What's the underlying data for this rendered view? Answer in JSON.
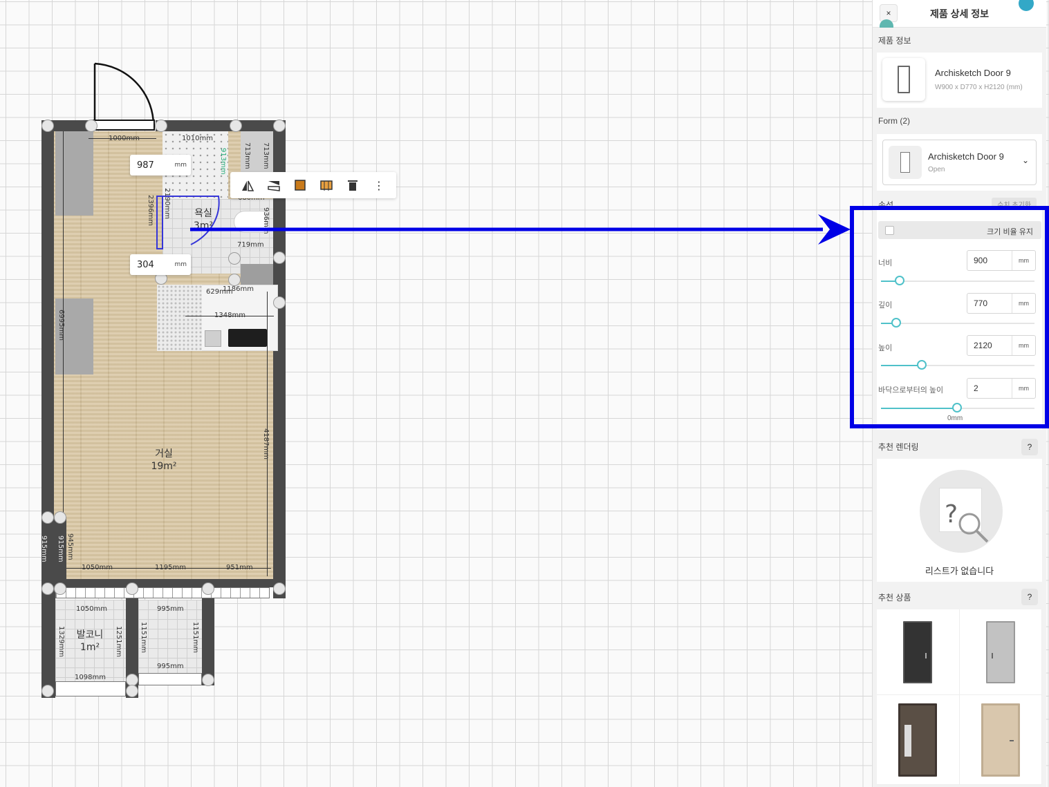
{
  "floorplan": {
    "dimensions": {
      "top_left": "1000mm",
      "top_bath": "1010mm",
      "bath_mid": "680mm",
      "right_v1": "713mm",
      "right_v2": "713mm",
      "bath_right_v": "936mm",
      "bath_h": "719mm",
      "bath_v_left": "2396mm",
      "bath_v_right": "2190mm",
      "small_v": "913mm",
      "kitchen_a": "629mm",
      "kitchen_b": "1186mm",
      "kitchen_w": "1348mm",
      "left_v": "6995mm",
      "right_v": "4187mm",
      "bottom_a": "1050mm",
      "bottom_b": "1195mm",
      "bottom_c": "951mm",
      "bottom_left_v1": "915mm",
      "bottom_left_v2": "915mm",
      "bottom_left_v3": "945mm",
      "balcony_top_a": "1050mm",
      "balcony_top_b": "995mm",
      "balcony_bottom_a": "1098mm",
      "balcony_bottom_b": "995mm",
      "balcony_v1": "1329mm",
      "balcony_v2": "1251mm",
      "balcony_v3": "1151mm",
      "balcony_v4": "1151mm"
    },
    "rooms": {
      "bathroom_name": "욕실",
      "bathroom_area": "3m²",
      "living_name": "거실",
      "living_area": "19m²",
      "balcony_name": "발코니",
      "balcony_area": "1m²"
    },
    "inputs": {
      "top_value": "987",
      "bottom_value": "304",
      "unit": "mm"
    }
  },
  "panel": {
    "title": "제품 상세 정보",
    "close_label": "×",
    "product_info_label": "제품 정보",
    "product_name": "Archisketch Door 9",
    "product_size": "W900 x D770 x H2120 (mm)",
    "form_label": "Form (2)",
    "form_name": "Archisketch Door 9",
    "form_state": "Open",
    "attr_label": "속성",
    "reset_label": "수치 초기화",
    "keep_ratio_label": "크기 비율 유지",
    "fields": {
      "width": {
        "label": "너비",
        "value": "900",
        "unit": "mm",
        "level": 0.13
      },
      "depth": {
        "label": "깊이",
        "value": "770",
        "unit": "mm",
        "level": 0.11
      },
      "height": {
        "label": "높이",
        "value": "2120",
        "unit": "mm",
        "level": 0.3
      },
      "elevation": {
        "label": "바닥으로부터의 높이",
        "value": "2",
        "unit": "mm",
        "level": 0.5,
        "sub": "0mm"
      }
    },
    "rendering_label": "추천 렌더링",
    "rendering_help": "?",
    "empty_text": "리스트가 없습니다",
    "recommend_label": "추천 상품",
    "recommend_help": "?",
    "recommend_colors": [
      "#3a3a3a",
      "#b9b9b9",
      "#5a4f45",
      "#d9c7ad"
    ]
  }
}
